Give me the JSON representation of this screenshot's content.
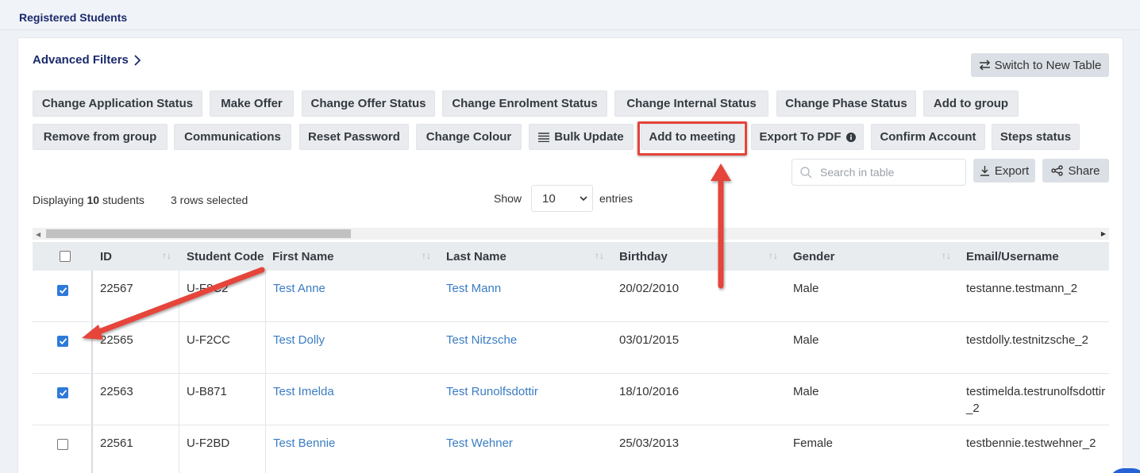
{
  "page": {
    "title": "Registered Students"
  },
  "filters": {
    "advanced_label": "Advanced Filters"
  },
  "switch_table": {
    "label": "Switch to New Table"
  },
  "actions": {
    "row1": [
      "Change Application Status",
      "Make Offer",
      "Change Offer Status",
      "Change Enrolment Status",
      "Change Internal Status",
      "Change Phase Status",
      "Add to group"
    ],
    "row2": [
      "Remove from group",
      "Communications",
      "Reset Password",
      "Change Colour",
      "Bulk Update",
      "Add to meeting",
      "Export To PDF",
      "Confirm Account",
      "Steps status"
    ]
  },
  "search": {
    "placeholder": "Search in table"
  },
  "toolbar": {
    "export_label": "Export",
    "share_label": "Share"
  },
  "summary": {
    "prefix": "Displaying",
    "count": "10",
    "suffix": "students",
    "selected": "3 rows selected"
  },
  "entries": {
    "show_label": "Show",
    "value": "10",
    "suffix": "entries"
  },
  "table": {
    "columns": [
      "ID",
      "Student Code",
      "First Name",
      "Last Name",
      "Birthday",
      "Gender",
      "Email/Username"
    ],
    "rows": [
      {
        "checked": true,
        "id": "22567",
        "code": "U-F8C2",
        "first": "Test Anne",
        "last": "Test Mann",
        "birthday": "20/02/2010",
        "gender": "Male",
        "email": "testanne.testmann_2"
      },
      {
        "checked": true,
        "id": "22565",
        "code": "U-F2CC",
        "first": "Test Dolly",
        "last": "Test Nitzsche",
        "birthday": "03/01/2015",
        "gender": "Male",
        "email": "testdolly.testnitzsche_2"
      },
      {
        "checked": true,
        "id": "22563",
        "code": "U-B871",
        "first": "Test Imelda",
        "last": "Test Runolfsdottir",
        "birthday": "18/10/2016",
        "gender": "Male",
        "email": "testimelda.testrunolfsdottir_2"
      },
      {
        "checked": false,
        "id": "22561",
        "code": "U-F2BD",
        "first": "Test Bennie",
        "last": "Test Wehner",
        "birthday": "25/03/2013",
        "gender": "Female",
        "email": "testbennie.testwehner_2"
      }
    ]
  },
  "colors": {
    "accent": "#1b2a6b",
    "link": "#3a7cc2",
    "checkbox": "#2e7ad8",
    "annotation": "#e5443a"
  },
  "icons": {
    "switch": "arrows-swap-icon",
    "bulk": "list-lines-icon",
    "info": "info-circle-icon",
    "search": "search-icon",
    "export": "download-icon",
    "share": "share-nodes-icon",
    "filters": "chevron-right-icon"
  }
}
